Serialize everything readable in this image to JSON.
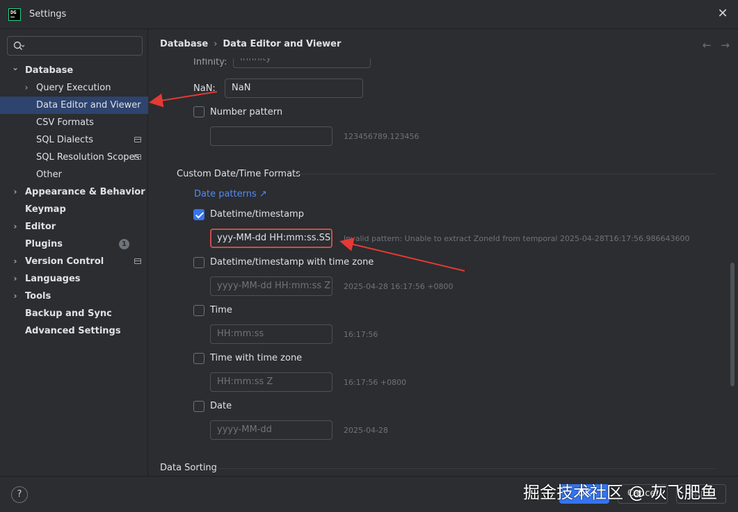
{
  "window": {
    "title": "Settings",
    "logo_text": "DG"
  },
  "search": {
    "placeholder": ""
  },
  "sidebar": {
    "items": [
      {
        "label": "Database",
        "level": 0,
        "expandable": true,
        "expanded": true,
        "bold": true
      },
      {
        "label": "Query Execution",
        "level": 1,
        "expandable": true
      },
      {
        "label": "Data Editor and Viewer",
        "level": 1,
        "selected": true
      },
      {
        "label": "CSV Formats",
        "level": 1
      },
      {
        "label": "SQL Dialects",
        "level": 1,
        "project_icon": true
      },
      {
        "label": "SQL Resolution Scopes",
        "level": 1,
        "project_icon": true
      },
      {
        "label": "Other",
        "level": 1
      },
      {
        "label": "Appearance & Behavior",
        "level": 0,
        "expandable": true,
        "bold": true
      },
      {
        "label": "Keymap",
        "level": 0,
        "bold": true
      },
      {
        "label": "Editor",
        "level": 0,
        "expandable": true,
        "bold": true
      },
      {
        "label": "Plugins",
        "level": 0,
        "bold": true,
        "badge": "1"
      },
      {
        "label": "Version Control",
        "level": 0,
        "expandable": true,
        "bold": true,
        "project_icon": true
      },
      {
        "label": "Languages",
        "level": 0,
        "expandable": true,
        "bold": true
      },
      {
        "label": "Tools",
        "level": 0,
        "expandable": true,
        "bold": true
      },
      {
        "label": "Backup and Sync",
        "level": 0,
        "bold": true
      },
      {
        "label": "Advanced Settings",
        "level": 0,
        "bold": true
      }
    ]
  },
  "breadcrumb": {
    "parent": "Database",
    "separator": "›",
    "current": "Data Editor and Viewer"
  },
  "nav": {
    "back": "←",
    "forward": "→"
  },
  "numbers": {
    "infinity_label": "Infinity:",
    "infinity_value": "Infinity",
    "nan_label": "NaN:",
    "nan_value": "NaN",
    "number_pattern_label": "Number pattern",
    "number_pattern_checked": false,
    "number_pattern_value": "",
    "number_pattern_example": "123456789.123456"
  },
  "datetime": {
    "section_title": "Custom Date/Time Formats",
    "link": "Date patterns ↗",
    "datetime_label": "Datetime/timestamp",
    "datetime_checked": true,
    "datetime_value": "yyy-MM-dd HH:mm:ss.SSS z",
    "datetime_error": "Invalid pattern: Unable to extract ZoneId from temporal 2025-04-28T16:17:56.986643600",
    "dtz_label": "Datetime/timestamp with time zone",
    "dtz_placeholder": "yyyy-MM-dd HH:mm:ss Z",
    "dtz_example": "2025-04-28 16:17:56 +0800",
    "time_label": "Time",
    "time_placeholder": "HH:mm:ss",
    "time_example": "16:17:56",
    "ttz_label": "Time with time zone",
    "ttz_placeholder": "HH:mm:ss Z",
    "ttz_example": "16:17:56 +0800",
    "date_label": "Date",
    "date_placeholder": "yyyy-MM-dd",
    "date_example": "2025-04-28"
  },
  "sorting": {
    "section_title": "Data Sorting"
  },
  "footer": {
    "help": "?",
    "ok": "OK",
    "cancel": "Cancel",
    "apply": "Apply",
    "watermark": "掘金技术社区 @ 灰飞肥鱼"
  },
  "colors": {
    "accent": "#3574f0",
    "selection": "#2e436e",
    "error": "#c94f4f",
    "annotation_arrow": "#e53935",
    "link": "#548af7"
  }
}
